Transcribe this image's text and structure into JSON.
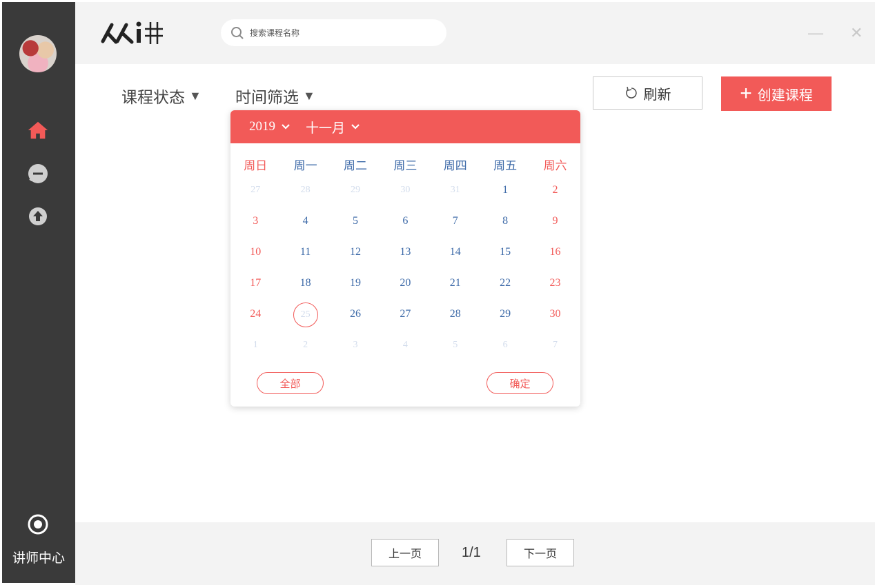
{
  "sidebar": {
    "bottom_label": "讲师中心"
  },
  "header": {
    "logo_text": "人人讲",
    "search_placeholder": "搜索课程名称",
    "minimize": "—",
    "close": "✕"
  },
  "filters": {
    "status_label": "课程状态",
    "time_label": "时间筛选",
    "arrow": "▼"
  },
  "actions": {
    "refresh_label": "刷新",
    "create_label": "创建课程",
    "create_plus": "+"
  },
  "calendar": {
    "year": "2019",
    "month": "十一月",
    "weekdays": [
      "周日",
      "周一",
      "周二",
      "周三",
      "周四",
      "周五",
      "周六"
    ],
    "weeks": [
      [
        "27",
        "28",
        "29",
        "30",
        "31",
        "1",
        "2"
      ],
      [
        "3",
        "4",
        "5",
        "6",
        "7",
        "8",
        "9"
      ],
      [
        "10",
        "11",
        "12",
        "13",
        "14",
        "15",
        "16"
      ],
      [
        "17",
        "18",
        "19",
        "20",
        "21",
        "22",
        "23"
      ],
      [
        "24",
        "25",
        "26",
        "27",
        "28",
        "29",
        "30"
      ],
      [
        "1",
        "2",
        "3",
        "4",
        "5",
        "6",
        "7"
      ]
    ],
    "all_label": "全部",
    "confirm_label": "确定"
  },
  "pagination": {
    "prev_label": "上一页",
    "page_text": "1/1",
    "next_label": "下一页"
  },
  "colors": {
    "accent": "#f25a58",
    "sidebar_bg": "#3a3a3a",
    "weekday_blue": "#3d6aa8"
  }
}
